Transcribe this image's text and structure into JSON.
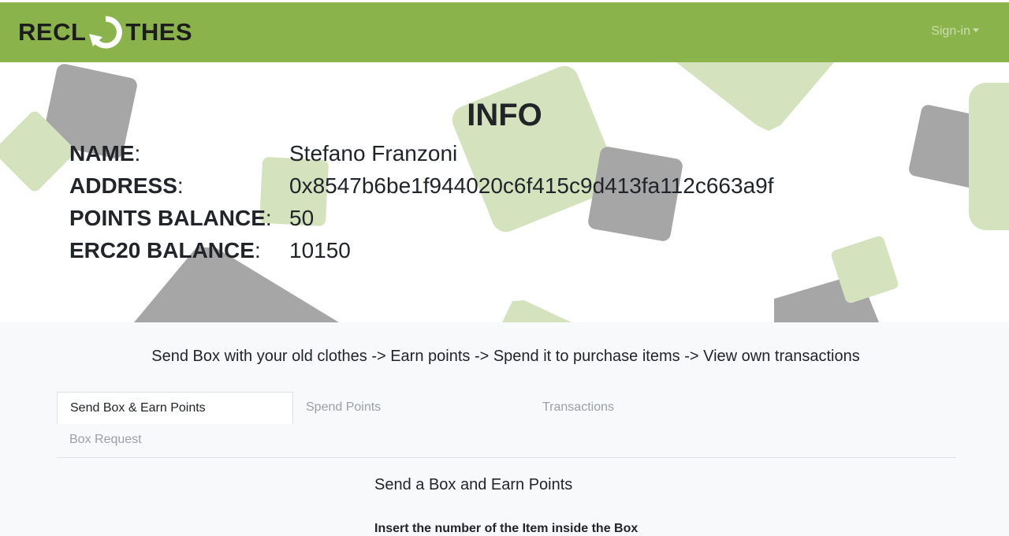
{
  "brand": {
    "left": "RECL",
    "right": "THES",
    "logo_icon": "recycle-arrow-icon"
  },
  "navbar": {
    "signin_label": "Sign-in",
    "bg_color": "#8ab34c"
  },
  "info": {
    "title": "INFO",
    "rows": [
      {
        "key": "NAME",
        "value": "Stefano Franzoni"
      },
      {
        "key": "ADDRESS",
        "value": "0x8547b6be1f944020c6f415c9d413fa112c663a9f"
      },
      {
        "key": "POINTS BALANCE",
        "value": "50"
      },
      {
        "key": "ERC20 BALANCE",
        "value": "10150"
      }
    ],
    "colon": ":"
  },
  "steps_text": "Send Box with your old clothes -> Earn points -> Spend it to purchase items -> View own transactions",
  "tabs": [
    {
      "label": "Send Box & Earn Points",
      "active": true
    },
    {
      "label": "Spend Points",
      "active": false
    },
    {
      "label": "Transactions",
      "active": false
    },
    {
      "label": "Box Request",
      "active": false
    }
  ],
  "section": {
    "title": "Send a Box and Earn Points",
    "field_label": "Insert the number of the Item inside the Box"
  },
  "colors": {
    "accent_green": "#8ab34c",
    "light_green": "#d4e3bd",
    "gray_shape": "#a5a6a5"
  }
}
